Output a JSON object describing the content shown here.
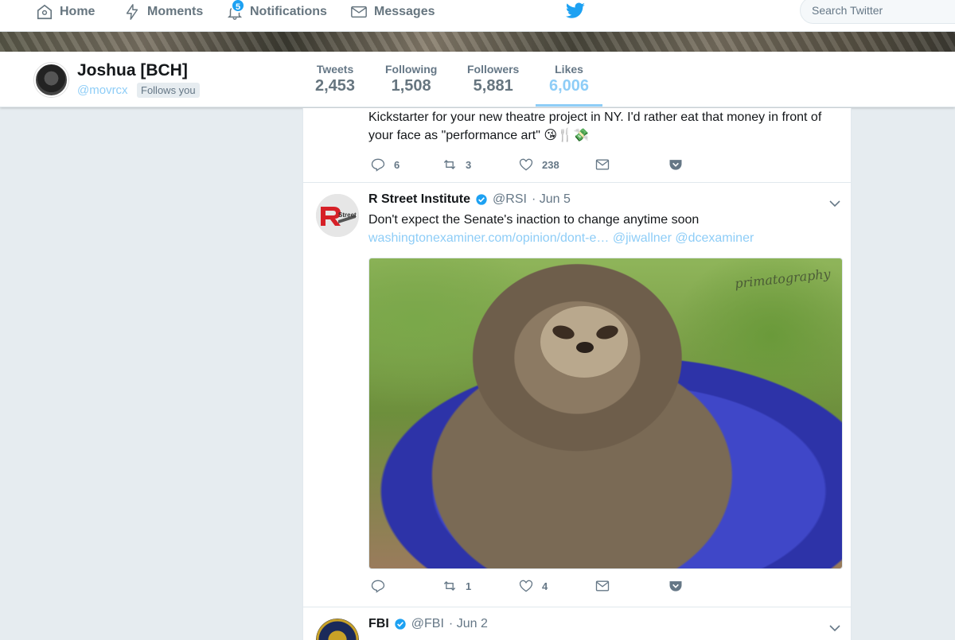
{
  "nav": {
    "home": "Home",
    "moments": "Moments",
    "notifications": "Notifications",
    "notifications_badge": "5",
    "messages": "Messages",
    "search_placeholder": "Search Twitter"
  },
  "profile": {
    "name": "Joshua [BCH]",
    "handle": "@movrcx",
    "follows_you": "Follows you",
    "stats": [
      {
        "label": "Tweets",
        "value": "2,453"
      },
      {
        "label": "Following",
        "value": "1,508"
      },
      {
        "label": "Followers",
        "value": "5,881"
      },
      {
        "label": "Likes",
        "value": "6,006"
      }
    ]
  },
  "tweets": [
    {
      "text_line1": "Kickstarter for your new theatre project in NY. I'd rather eat that money in front of",
      "text_line2": "your face as \"performance art\" 😘🍴💸",
      "replies": "6",
      "retweets": "3",
      "likes": "238"
    },
    {
      "name": "R Street Institute",
      "handle": "@RSI",
      "date": "· Jun 5",
      "text": "Don't expect the Senate's inaction to change anytime soon",
      "link": "washingtonexaminer.com/opinion/dont-e…",
      "mention1": "@jiwallner",
      "mention2": "@dcexaminer",
      "avatar_label": "Street",
      "media_watermark": "primatography",
      "replies": "",
      "retweets": "1",
      "likes": "4"
    },
    {
      "name": "FBI",
      "handle": "@FBI",
      "date": "· Jun 2"
    }
  ],
  "colors": {
    "accent": "#1da1f2",
    "link_light": "#8ecdf7",
    "muted": "#657786",
    "background": "#e6ecf0"
  }
}
